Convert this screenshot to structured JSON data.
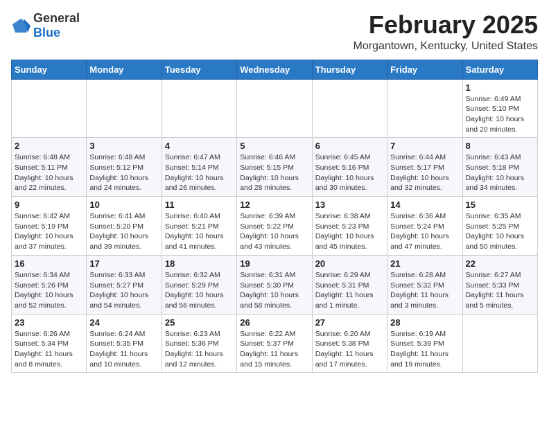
{
  "header": {
    "logo_general": "General",
    "logo_blue": "Blue",
    "month_title": "February 2025",
    "location": "Morgantown, Kentucky, United States"
  },
  "weekdays": [
    "Sunday",
    "Monday",
    "Tuesday",
    "Wednesday",
    "Thursday",
    "Friday",
    "Saturday"
  ],
  "weeks": [
    [
      {
        "day": "",
        "info": ""
      },
      {
        "day": "",
        "info": ""
      },
      {
        "day": "",
        "info": ""
      },
      {
        "day": "",
        "info": ""
      },
      {
        "day": "",
        "info": ""
      },
      {
        "day": "",
        "info": ""
      },
      {
        "day": "1",
        "info": "Sunrise: 6:49 AM\nSunset: 5:10 PM\nDaylight: 10 hours\nand 20 minutes."
      }
    ],
    [
      {
        "day": "2",
        "info": "Sunrise: 6:48 AM\nSunset: 5:11 PM\nDaylight: 10 hours\nand 22 minutes."
      },
      {
        "day": "3",
        "info": "Sunrise: 6:48 AM\nSunset: 5:12 PM\nDaylight: 10 hours\nand 24 minutes."
      },
      {
        "day": "4",
        "info": "Sunrise: 6:47 AM\nSunset: 5:14 PM\nDaylight: 10 hours\nand 26 minutes."
      },
      {
        "day": "5",
        "info": "Sunrise: 6:46 AM\nSunset: 5:15 PM\nDaylight: 10 hours\nand 28 minutes."
      },
      {
        "day": "6",
        "info": "Sunrise: 6:45 AM\nSunset: 5:16 PM\nDaylight: 10 hours\nand 30 minutes."
      },
      {
        "day": "7",
        "info": "Sunrise: 6:44 AM\nSunset: 5:17 PM\nDaylight: 10 hours\nand 32 minutes."
      },
      {
        "day": "8",
        "info": "Sunrise: 6:43 AM\nSunset: 5:18 PM\nDaylight: 10 hours\nand 34 minutes."
      }
    ],
    [
      {
        "day": "9",
        "info": "Sunrise: 6:42 AM\nSunset: 5:19 PM\nDaylight: 10 hours\nand 37 minutes."
      },
      {
        "day": "10",
        "info": "Sunrise: 6:41 AM\nSunset: 5:20 PM\nDaylight: 10 hours\nand 39 minutes."
      },
      {
        "day": "11",
        "info": "Sunrise: 6:40 AM\nSunset: 5:21 PM\nDaylight: 10 hours\nand 41 minutes."
      },
      {
        "day": "12",
        "info": "Sunrise: 6:39 AM\nSunset: 5:22 PM\nDaylight: 10 hours\nand 43 minutes."
      },
      {
        "day": "13",
        "info": "Sunrise: 6:38 AM\nSunset: 5:23 PM\nDaylight: 10 hours\nand 45 minutes."
      },
      {
        "day": "14",
        "info": "Sunrise: 6:36 AM\nSunset: 5:24 PM\nDaylight: 10 hours\nand 47 minutes."
      },
      {
        "day": "15",
        "info": "Sunrise: 6:35 AM\nSunset: 5:25 PM\nDaylight: 10 hours\nand 50 minutes."
      }
    ],
    [
      {
        "day": "16",
        "info": "Sunrise: 6:34 AM\nSunset: 5:26 PM\nDaylight: 10 hours\nand 52 minutes."
      },
      {
        "day": "17",
        "info": "Sunrise: 6:33 AM\nSunset: 5:27 PM\nDaylight: 10 hours\nand 54 minutes."
      },
      {
        "day": "18",
        "info": "Sunrise: 6:32 AM\nSunset: 5:29 PM\nDaylight: 10 hours\nand 56 minutes."
      },
      {
        "day": "19",
        "info": "Sunrise: 6:31 AM\nSunset: 5:30 PM\nDaylight: 10 hours\nand 58 minutes."
      },
      {
        "day": "20",
        "info": "Sunrise: 6:29 AM\nSunset: 5:31 PM\nDaylight: 11 hours\nand 1 minute."
      },
      {
        "day": "21",
        "info": "Sunrise: 6:28 AM\nSunset: 5:32 PM\nDaylight: 11 hours\nand 3 minutes."
      },
      {
        "day": "22",
        "info": "Sunrise: 6:27 AM\nSunset: 5:33 PM\nDaylight: 11 hours\nand 5 minutes."
      }
    ],
    [
      {
        "day": "23",
        "info": "Sunrise: 6:26 AM\nSunset: 5:34 PM\nDaylight: 11 hours\nand 8 minutes."
      },
      {
        "day": "24",
        "info": "Sunrise: 6:24 AM\nSunset: 5:35 PM\nDaylight: 11 hours\nand 10 minutes."
      },
      {
        "day": "25",
        "info": "Sunrise: 6:23 AM\nSunset: 5:36 PM\nDaylight: 11 hours\nand 12 minutes."
      },
      {
        "day": "26",
        "info": "Sunrise: 6:22 AM\nSunset: 5:37 PM\nDaylight: 11 hours\nand 15 minutes."
      },
      {
        "day": "27",
        "info": "Sunrise: 6:20 AM\nSunset: 5:38 PM\nDaylight: 11 hours\nand 17 minutes."
      },
      {
        "day": "28",
        "info": "Sunrise: 6:19 AM\nSunset: 5:39 PM\nDaylight: 11 hours\nand 19 minutes."
      },
      {
        "day": "",
        "info": ""
      }
    ]
  ]
}
